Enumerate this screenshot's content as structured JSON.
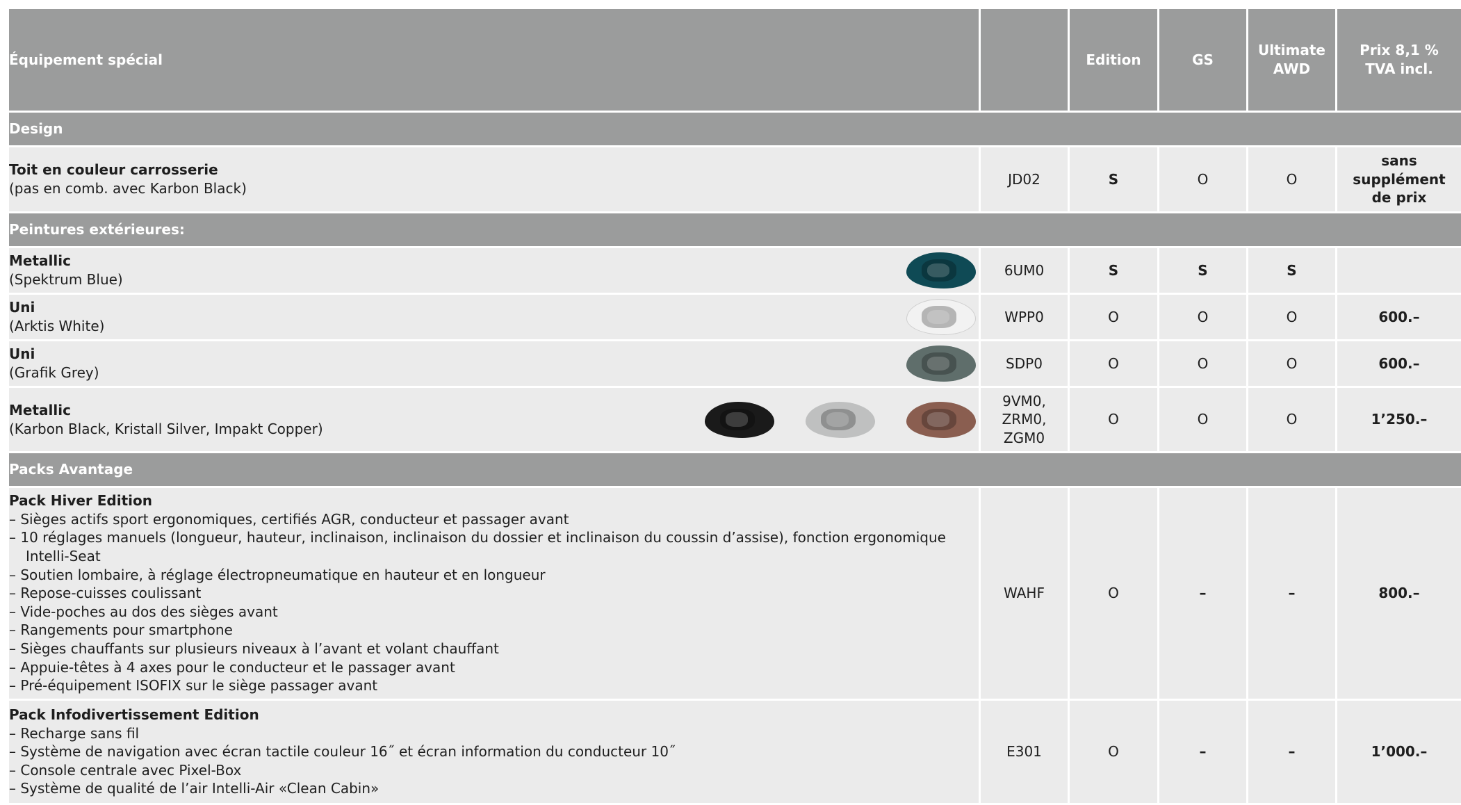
{
  "header": {
    "title": "Équipement spécial",
    "code": "",
    "col1": "Edition",
    "col2": "GS",
    "col3": "Ultimate AWD",
    "col4": "Prix 8,1 % TVA incl."
  },
  "sections": {
    "design": "Design",
    "paints": "Peintures extérieures:",
    "packs": "Packs Avantage"
  },
  "rows": {
    "roof": {
      "name": "Toit en couleur carrosserie",
      "sub": "(pas en comb. avec Karbon Black)",
      "code": "JD02",
      "c1": "S",
      "c2": "O",
      "c3": "O",
      "price": "sans supplément de prix"
    },
    "metallic_blue": {
      "name": "Metallic",
      "sub": "(Spektrum Blue)",
      "code": "6UM0",
      "c1": "S",
      "c2": "S",
      "c3": "S",
      "price": ""
    },
    "uni_white": {
      "name": "Uni",
      "sub": "(Arktis White)",
      "code": "WPP0",
      "c1": "O",
      "c2": "O",
      "c3": "O",
      "price": "600.–"
    },
    "uni_grey": {
      "name": "Uni",
      "sub": "(Grafik Grey)",
      "code": "SDP0",
      "c1": "O",
      "c2": "O",
      "c3": "O",
      "price": "600.–"
    },
    "metallic_multi": {
      "name": "Metallic",
      "sub": "(Karbon Black, Kristall Silver, Impakt Copper)",
      "code": [
        "9VM0,",
        "ZRM0,",
        "ZGM0"
      ],
      "c1": "O",
      "c2": "O",
      "c3": "O",
      "price": "1’250.–"
    },
    "pack_hiver": {
      "name": "Pack Hiver Edition",
      "items": [
        "–  Sièges actifs sport ergonomiques, certifiés AGR, conducteur et passager avant",
        "–  10 réglages manuels (longueur, hauteur, inclinaison, inclinaison du dossier et inclinaison du coussin d’assise), fonction ergonomique Intelli-Seat",
        "–  Soutien lombaire, à réglage électropneumatique en hauteur et en longueur",
        "–  Repose-cuisses coulissant",
        "–  Vide-poches au dos des sièges avant",
        "–  Rangements pour smartphone",
        "–  Sièges chauffants sur plusieurs niveaux à l’avant et volant chauffant",
        "–  Appuie-têtes à 4 axes pour le conducteur et le passager avant",
        "–  Pré-équipement ISOFIX sur le siège passager avant"
      ],
      "code": "WAHF",
      "c1": "O",
      "c2": "–",
      "c3": "–",
      "price": "800.–"
    },
    "pack_info": {
      "name": "Pack Infodivertissement Edition",
      "items": [
        "–  Recharge sans fil",
        "–  Système de navigation avec écran tactile couleur 16˝ et écran information du conducteur 10˝",
        "–  Console centrale avec Pixel-Box",
        "–  Système de qualité de l’air Intelli-Air «Clean Cabin»"
      ],
      "code": "E301",
      "c1": "O",
      "c2": "–",
      "c3": "–",
      "price": "1’000.–"
    }
  },
  "colors": {
    "header_bg": "#9b9c9c",
    "row_bg": "#ebebeb",
    "spektrum_blue": "#0f4a55",
    "arktis_white": "#f2f2f2",
    "grafik_grey": "#5f6e6b",
    "karbon_black": "#1a1a1a",
    "kristall_silver": "#bfc0c0",
    "impakt_copper": "#8a5e50"
  },
  "swatches": {
    "blue": "car-swatch-spektrum-blue",
    "white": "car-swatch-arktis-white",
    "grey": "car-swatch-grafik-grey",
    "black": "car-swatch-karbon-black",
    "silver": "car-swatch-kristall-silver",
    "copper": "car-swatch-impakt-copper"
  }
}
